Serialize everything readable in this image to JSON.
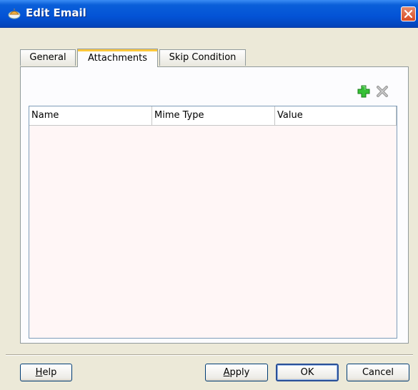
{
  "window": {
    "title": "Edit Email"
  },
  "tabs": [
    {
      "label": "General",
      "active": false
    },
    {
      "label": "Attachments",
      "active": true
    },
    {
      "label": "Skip Condition",
      "active": false
    }
  ],
  "toolbar": {
    "add_icon": "add-icon",
    "remove_icon": "remove-icon"
  },
  "table": {
    "columns": [
      "Name",
      "Mime Type",
      "Value"
    ],
    "rows": []
  },
  "buttons": {
    "help": {
      "mnemonic": "H",
      "rest": "elp"
    },
    "apply": {
      "mnemonic": "A",
      "rest": "pply"
    },
    "ok": "OK",
    "cancel": "Cancel"
  },
  "colors": {
    "titlebar": "#0353d6",
    "table_background": "#fff6f6",
    "active_tab_highlight": "#ffc83c",
    "add_icon": "#2fb52f"
  }
}
